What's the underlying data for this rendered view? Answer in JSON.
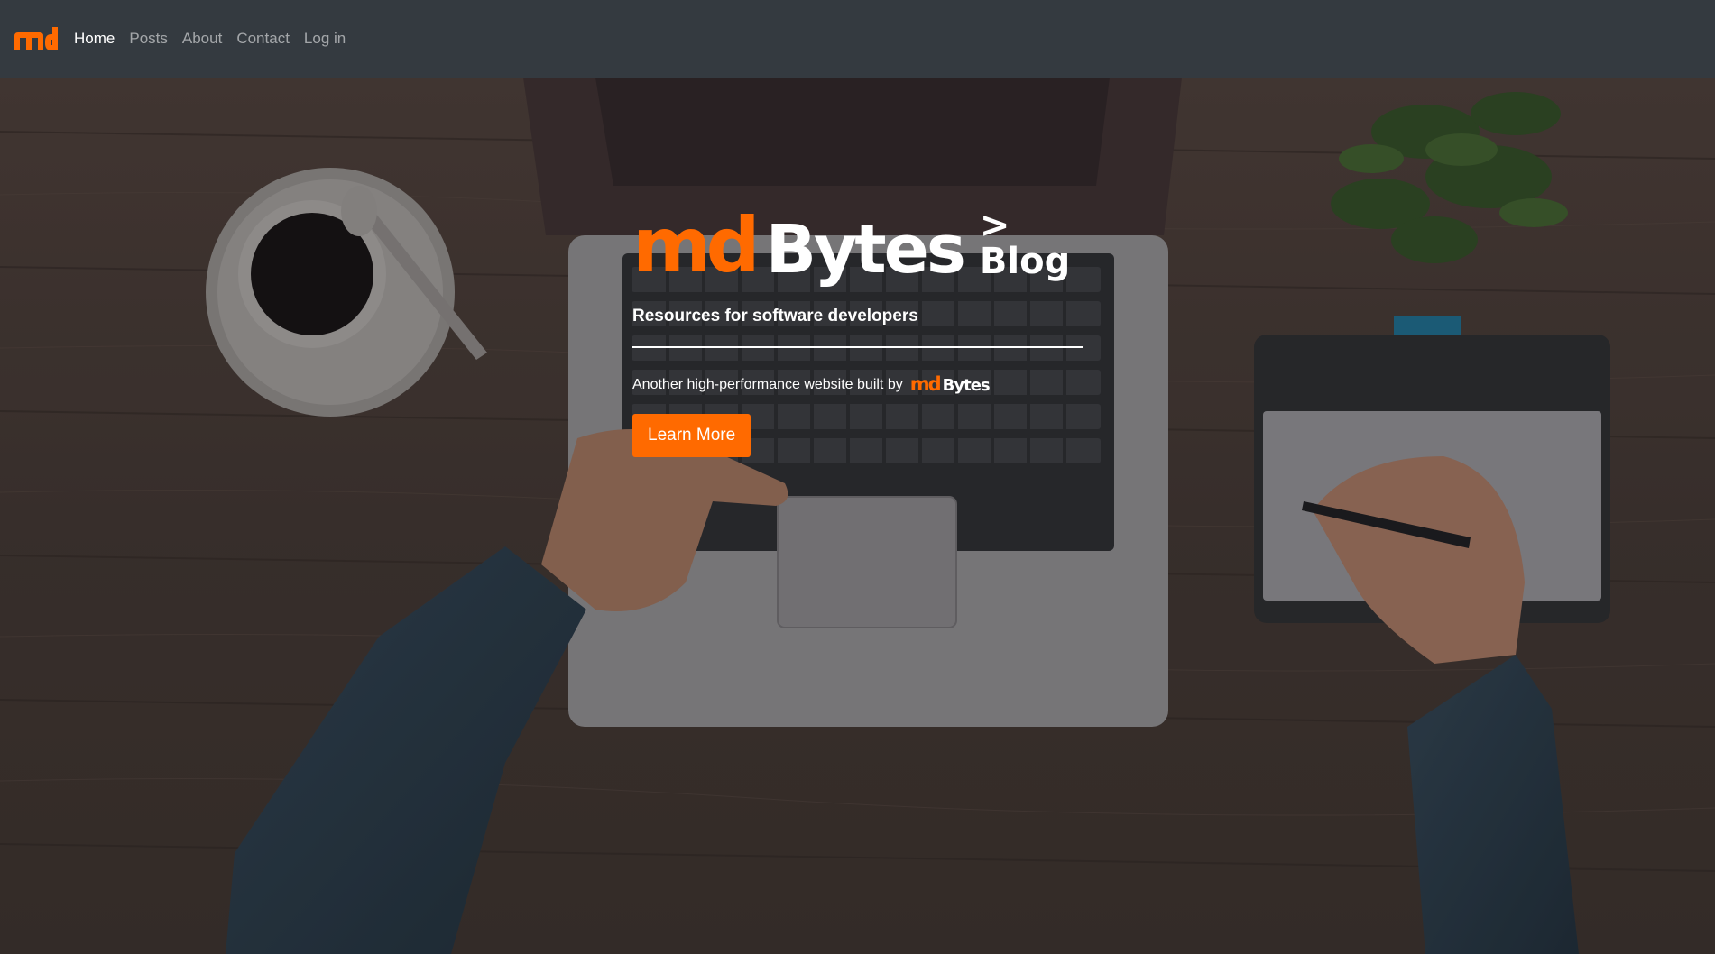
{
  "navbar": {
    "brand": "md",
    "brand_color": "#ff6a00",
    "background": "#343a40",
    "links": [
      {
        "label": "Home",
        "active": true
      },
      {
        "label": "Posts",
        "active": false
      },
      {
        "label": "About",
        "active": false
      },
      {
        "label": "Contact",
        "active": false
      },
      {
        "label": "Log in",
        "active": false
      }
    ]
  },
  "hero": {
    "logo_md": "md",
    "logo_bytes": "Bytes",
    "logo_blog": "> Blog",
    "tagline": "Resources for software developers",
    "built_by_text": "Another high-performance website built by",
    "mini_logo_md": "md",
    "mini_logo_bytes": "Bytes",
    "cta_label": "Learn More",
    "accent_color": "#ff6a00"
  }
}
